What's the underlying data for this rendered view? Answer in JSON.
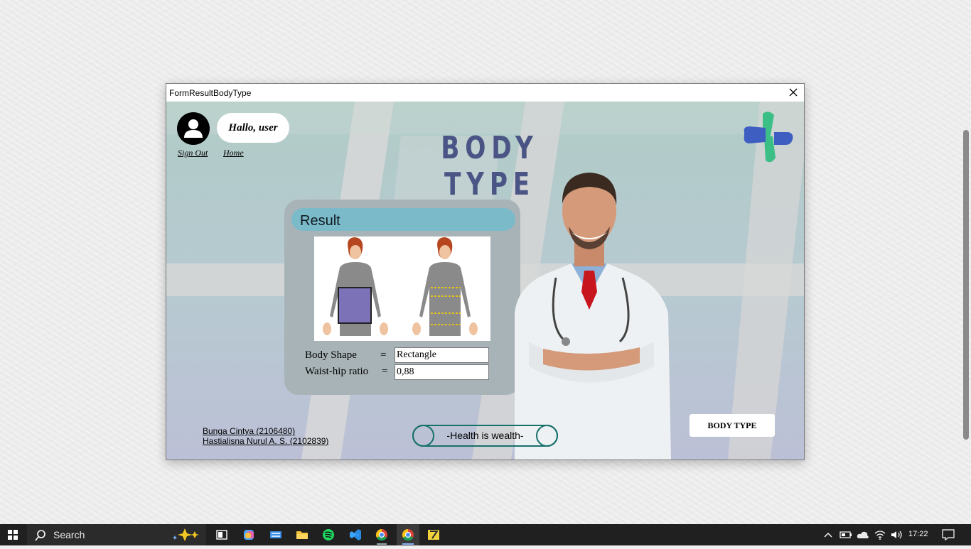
{
  "window": {
    "title": "FormResultBodyType"
  },
  "header": {
    "greeting": "Hallo, user",
    "sign_out": "Sign Out",
    "home": "Home",
    "page_title": "BODY TYPE"
  },
  "result": {
    "title": "Result",
    "body_shape_label": "Body Shape",
    "body_shape_value": "Rectangle",
    "ratio_label": "Waist-hip ratio",
    "ratio_value": "0,88",
    "equals": "="
  },
  "footer": {
    "credit_1": "Bunga Cintya (2106480)",
    "credit_2": "Hastialisna Nurul A. S. (2102839)",
    "motto": "-Health is wealth-",
    "body_type_button": "BODY TYPE"
  },
  "taskbar": {
    "search_placeholder": "Search",
    "time": "17:22"
  },
  "colors": {
    "title": "#4a5585",
    "result_header": "#7bbac9",
    "logo_green": "#3bbf86",
    "logo_blue": "#3e5ec2",
    "motto_border": "#17716b",
    "body_rect": "#7b72b8"
  },
  "icons": [
    "user-avatar-icon",
    "close-icon",
    "medical-cross-logo",
    "windows-start-icon",
    "search-icon",
    "task-view-icon",
    "copilot-icon",
    "keyboard-icon",
    "file-explorer-icon",
    "spotify-icon",
    "vscode-icon",
    "chrome-icon",
    "chrome-active-icon",
    "winrar-icon",
    "chevron-up-icon",
    "battery-icon",
    "onedrive-icon",
    "wifi-icon",
    "volume-icon",
    "notification-icon"
  ]
}
